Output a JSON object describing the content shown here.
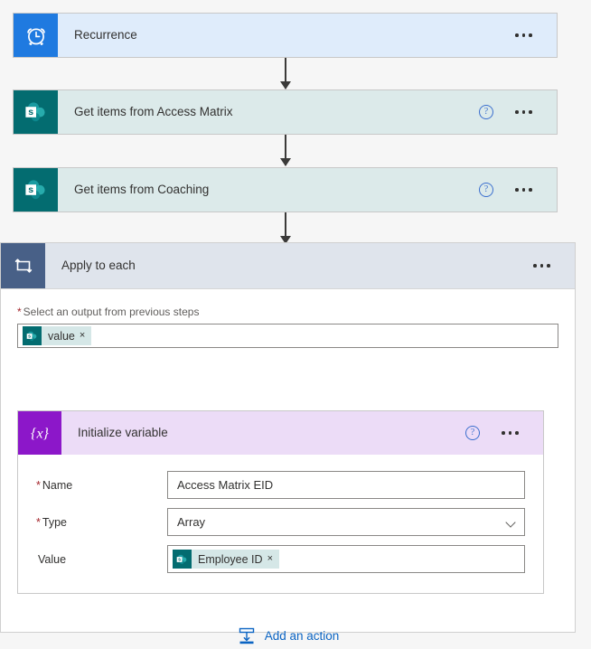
{
  "flow": {
    "steps": [
      {
        "id": "recurrence",
        "title": "Recurrence",
        "icon": "alarm-clock-icon",
        "has_help": false,
        "icon_bg": "#1f7ae0",
        "body_bg": "#dfecfb"
      },
      {
        "id": "get-items-access-matrix",
        "title": "Get items from Access Matrix",
        "icon": "sharepoint-icon",
        "has_help": true,
        "icon_bg": "#036c70",
        "body_bg": "#dceaea"
      },
      {
        "id": "get-items-coaching",
        "title": "Get items from Coaching",
        "icon": "sharepoint-icon",
        "has_help": true,
        "icon_bg": "#036c70",
        "body_bg": "#dceaea"
      }
    ]
  },
  "scope": {
    "title": "Apply to each",
    "icon": "loop-repeat-icon",
    "icon_bg": "#486087",
    "header_bg": "#dfe4ec",
    "output_field": {
      "required_marker": "*",
      "label": "Select an output from previous steps",
      "token": {
        "icon": "sharepoint-icon",
        "label": "value",
        "remove": "×"
      }
    }
  },
  "initialize_variable": {
    "title": "Initialize variable",
    "icon": "expression-braces-icon",
    "icon_bg": "#8c17c9",
    "header_bg": "#ecdcf7",
    "has_help": true,
    "fields": {
      "name": {
        "required_marker": "*",
        "label": "Name",
        "value": "Access Matrix EID"
      },
      "type": {
        "required_marker": "*",
        "label": "Type",
        "value": "Array",
        "options": [
          "Array"
        ]
      },
      "value": {
        "required_marker": "",
        "label": "Value",
        "token": {
          "icon": "sharepoint-icon",
          "label": "Employee ID",
          "remove": "×"
        }
      }
    }
  },
  "add_action": {
    "label": "Add an action",
    "icon": "insert-action-icon",
    "color": "#0b64c3"
  },
  "overflow_menu": {
    "label": "More commands"
  },
  "help": {
    "label": "?"
  }
}
